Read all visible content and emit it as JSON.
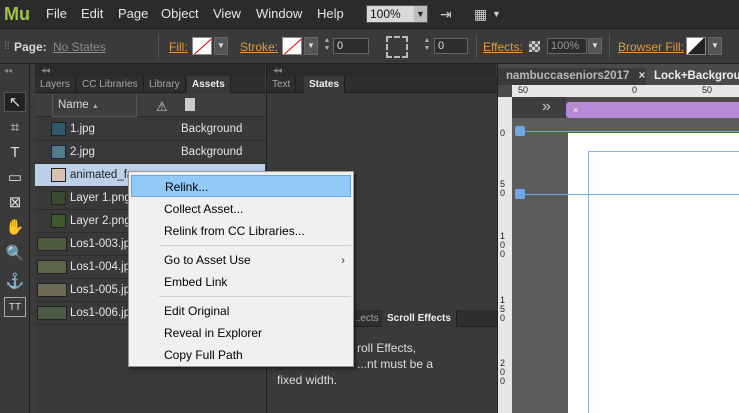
{
  "app": {
    "logo": "Mu"
  },
  "menubar": {
    "items": [
      "File",
      "Edit",
      "Page",
      "Object",
      "View",
      "Window",
      "Help"
    ],
    "zoom": "100%"
  },
  "controlbar": {
    "page_label": "Page:",
    "page_value": "No States",
    "fill_label": "Fill:",
    "stroke_label": "Stroke:",
    "stroke_width": "0",
    "corner_value": "0",
    "effects_label": "Effects:",
    "opacity": "100%",
    "browser_fill_label": "Browser Fill:"
  },
  "panel1": {
    "tabs": [
      "Layers",
      "CC Libraries",
      "Library",
      "Assets"
    ],
    "header": {
      "name_col": "Name",
      "sort_arrow": "▲"
    },
    "assets": [
      {
        "name": "1.jpg",
        "page": "Background"
      },
      {
        "name": "2.jpg",
        "page": "Background"
      },
      {
        "name": "animated_fa",
        "page": ""
      },
      {
        "name": "Layer 1.png",
        "page": ""
      },
      {
        "name": "Layer 2.png",
        "page": ""
      },
      {
        "name": "Los1-003.jp",
        "page": ""
      },
      {
        "name": "Los1-004.jp",
        "page": ""
      },
      {
        "name": "Los1-005.jp",
        "page": ""
      },
      {
        "name": "Los1-006.jp",
        "page": ""
      }
    ]
  },
  "panel2": {
    "tabs": [
      "Text",
      "States"
    ],
    "lower_tabs": [
      "...ects Lib",
      "Scroll Effects"
    ],
    "scroll_text": [
      "roll Effects,",
      "...nt must be a",
      "fixed width."
    ]
  },
  "design": {
    "tabs": [
      "nambuccaseniors2017",
      "Lock+Backgrou"
    ],
    "close_glyph": "×",
    "ruler_top": [
      "50",
      "0",
      "50"
    ],
    "ruler_left": [
      "0",
      "5\n0",
      "1\n0\n0",
      "1\n5\n0",
      "2\n0\n0"
    ],
    "breakpoint_arrows": "»"
  },
  "context_menu": {
    "items": [
      {
        "label": "Relink...",
        "highlighted": true
      },
      {
        "label": "Collect Asset..."
      },
      {
        "label": "Relink from CC Libraries..."
      },
      {
        "label": "Go to Asset Use",
        "submenu": true
      },
      {
        "label": "Embed Link"
      },
      {
        "label": "Edit Original"
      },
      {
        "label": "Reveal in Explorer"
      },
      {
        "label": "Copy Full Path"
      }
    ]
  },
  "colors": {
    "accent_orange": "#e49a3a",
    "logo_green": "#9ec24a",
    "selection_blue": "#bcd0ea",
    "menu_highlight": "#91c9f7",
    "breakpoint_purple": "#b58ad6"
  },
  "icons": [
    "select-icon",
    "crop-icon",
    "text-icon",
    "rectangle-icon",
    "image-frame-icon",
    "hand-icon",
    "zoom-icon",
    "anchor-icon",
    "text-frame-icon",
    "warning-icon",
    "page-icon"
  ]
}
